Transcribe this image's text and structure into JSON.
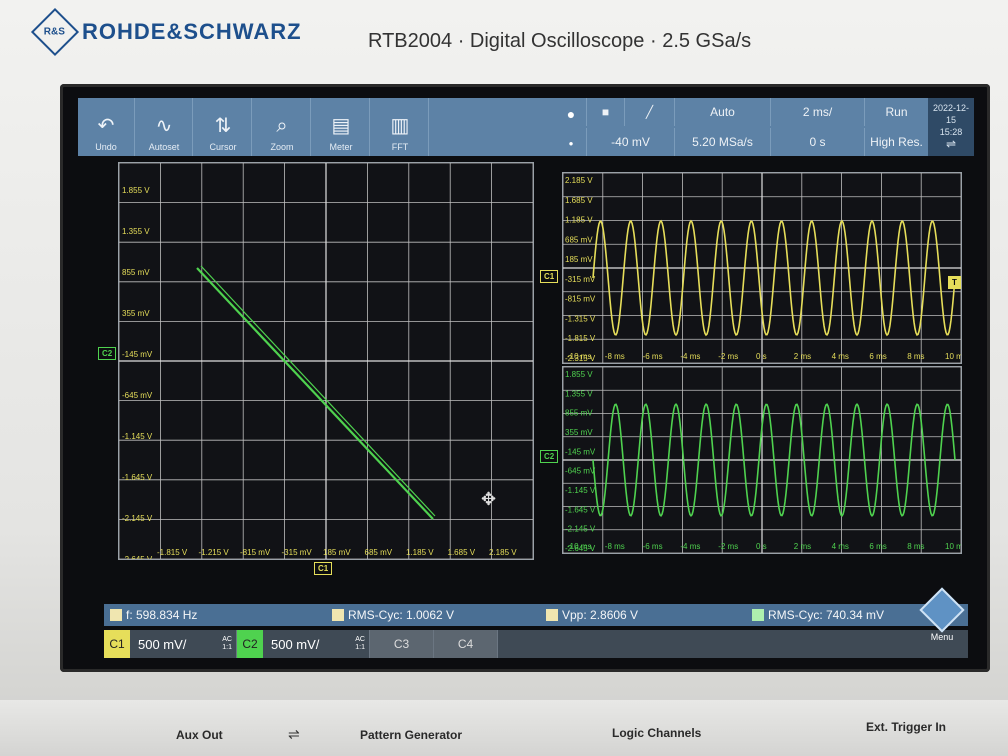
{
  "brand": {
    "name": "ROHDE&SCHWARZ",
    "logo_text": "R&S"
  },
  "model": "RTB2004 · Digital Oscilloscope · 2.5 GSa/s",
  "toolbar": {
    "buttons": [
      {
        "label": "Undo",
        "icon": "undo-icon"
      },
      {
        "label": "Autoset",
        "icon": "autoset-icon"
      },
      {
        "label": "Cursor",
        "icon": "cursor-icon"
      },
      {
        "label": "Zoom",
        "icon": "zoom-icon"
      },
      {
        "label": "Meter",
        "icon": "meter-icon"
      },
      {
        "label": "FFT",
        "icon": "fft-icon"
      }
    ],
    "settings_top": [
      "",
      "",
      "Auto",
      "2 ms/",
      "Run"
    ],
    "settings_bottom": [
      "-40 mV",
      "5.20 MSa/s",
      "0 s",
      "High Res."
    ],
    "date": "2022-12-15",
    "time": "15:28"
  },
  "xy_plot": {
    "y_ticks": [
      "1.855 V",
      "1.355 V",
      "855 mV",
      "355 mV",
      "-145 mV",
      "-645 mV",
      "-1.145 V",
      "-1.645 V",
      "-2.145 V",
      "-2.645 V"
    ],
    "x_ticks": [
      "-1.815 V",
      "-1.215 V",
      "-815 mV",
      "-315 mV",
      "185 mV",
      "685 mV",
      "1.185 V",
      "1.685 V",
      "2.185 V"
    ],
    "y_marker": "C2",
    "x_marker": "C1"
  },
  "ch1_plot": {
    "marker": "C1",
    "y_ticks": [
      "2.185 V",
      "1.685 V",
      "1.185 V",
      "685 mV",
      "185 mV",
      "-315 mV",
      "-815 mV",
      "-1.315 V",
      "-1.815 V",
      "-2.315 V"
    ],
    "x_ticks": [
      "-10 ms",
      "-8 ms",
      "-6 ms",
      "-4 ms",
      "-2 ms",
      "0 s",
      "2 ms",
      "4 ms",
      "6 ms",
      "8 ms",
      "10 ms"
    ]
  },
  "ch2_plot": {
    "marker": "C2",
    "y_ticks": [
      "1.855 V",
      "1.355 V",
      "855 mV",
      "355 mV",
      "-145 mV",
      "-645 mV",
      "-1.145 V",
      "-1.645 V",
      "-2.145 V",
      "-2.645 V"
    ],
    "x_ticks": [
      "-10 ms",
      "-8 ms",
      "-6 ms",
      "-4 ms",
      "-2 ms",
      "0 s",
      "2 ms",
      "4 ms",
      "6 ms",
      "8 ms",
      "10 ms"
    ]
  },
  "measurements": [
    {
      "label": "f: 598.834 Hz"
    },
    {
      "label": "RMS-Cyc: 1.0062 V"
    },
    {
      "label": "Vpp: 2.8606 V"
    },
    {
      "label": "RMS-Cyc: 740.34 mV"
    }
  ],
  "channels": [
    {
      "tag": "C1",
      "scale": "500 mV/",
      "coupling": "AC",
      "probe": "1:1",
      "color": "#e6de5a"
    },
    {
      "tag": "C2",
      "scale": "500 mV/",
      "coupling": "AC",
      "probe": "1:1",
      "color": "#4fd24f"
    },
    {
      "tag": "C3",
      "scale": "",
      "coupling": "",
      "probe": "",
      "color": "#9aa3ad"
    },
    {
      "tag": "C4",
      "scale": "",
      "coupling": "",
      "probe": "",
      "color": "#9aa3ad"
    }
  ],
  "menu_label": "Menu",
  "front_panel": {
    "aux_out": "Aux Out",
    "pattern_generator": "Pattern Generator",
    "logic_channels": "Logic Channels",
    "ext_trigger": "Ext. Trigger In"
  },
  "colors": {
    "ch1": "#e6de5a",
    "ch2": "#4fd24f",
    "grid": "#c8c8c8",
    "toolbar": "#5d82a6"
  }
}
